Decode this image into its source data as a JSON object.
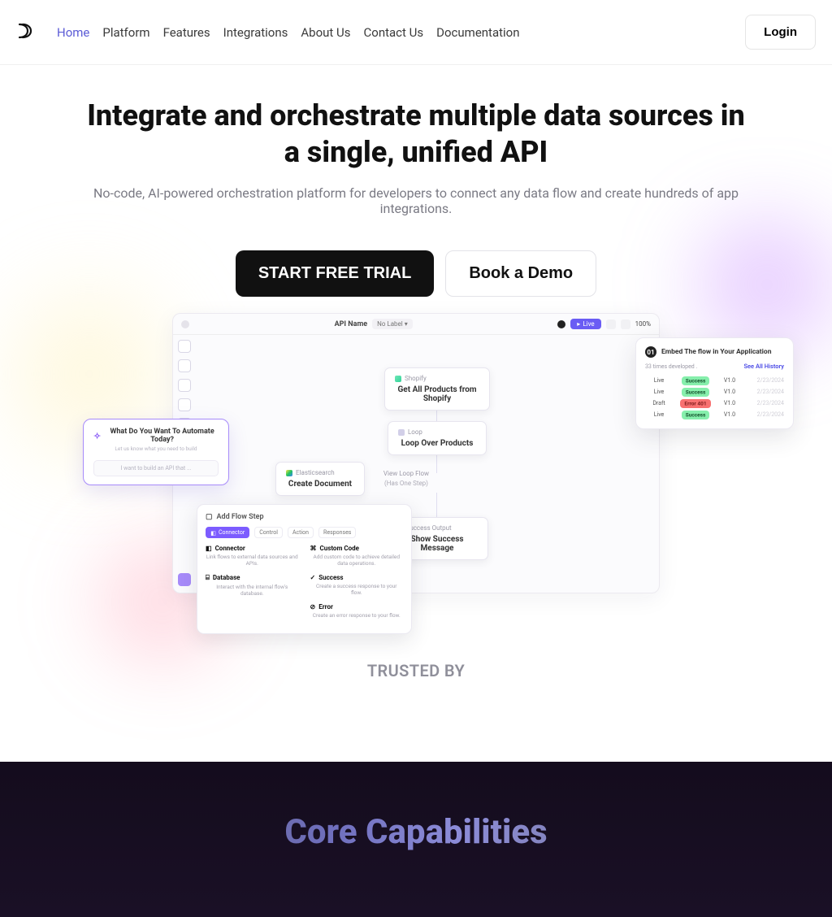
{
  "nav": {
    "links": [
      "Home",
      "Platform",
      "Features",
      "Integrations",
      "About Us",
      "Contact Us",
      "Documentation"
    ],
    "active_index": 0,
    "login": "Login"
  },
  "hero": {
    "title": "Integrate and orchestrate multiple data sources in a single, unified API",
    "subtitle": "No-code, AI-powered orchestration platform for developers to connect any data flow and create hundreds of app integrations.",
    "cta_primary": "START FREE TRIAL",
    "cta_secondary": "Book a Demo"
  },
  "mock": {
    "header": {
      "title": "API Name",
      "label": "No Label ▾",
      "live": "Live",
      "zoom": "100%"
    },
    "nodes": {
      "shopify": {
        "tag": "Shopify",
        "title": "Get All Products from Shopify"
      },
      "loop": {
        "tag": "Loop",
        "title": "Loop Over Products"
      },
      "elastic": {
        "tag": "Elasticsearch",
        "title": "Create Document"
      },
      "viewloop": {
        "tag": "View Loop Flow",
        "sub": "(Has One Step)"
      },
      "success": {
        "tag": "Success Output",
        "title": "Show Success Message"
      }
    },
    "automate": {
      "title": "What Do You Want To Automate Today?",
      "subtitle": "Let us know what you need to build",
      "placeholder": "I want to build an API that ..."
    },
    "add_step": {
      "header": "Add Flow Step",
      "chips": [
        "Connector",
        "Control",
        "Action",
        "Responses"
      ],
      "items": [
        {
          "t": "Connector",
          "d": "Link flows to external data sources and APIs."
        },
        {
          "t": "Database",
          "d": "Interact with the internal flow's database."
        },
        {
          "t": "Custom Code",
          "d": "Add custom code to achieve detailed data operations."
        },
        {
          "t": "Success",
          "d": "Create a success response to your flow."
        },
        {
          "t": "Error",
          "d": "Create an error response to your flow."
        }
      ]
    },
    "embed": {
      "title": "Embed The flow in Your Application",
      "count_label": "33 times developed .",
      "history_link": "See All History",
      "step_no": "01",
      "rows": [
        {
          "status": "Live",
          "result": "Success",
          "ver": "V1.0",
          "date": "2/23/2024",
          "ok": true
        },
        {
          "status": "Live",
          "result": "Success",
          "ver": "V1.0",
          "date": "2/23/2024",
          "ok": true
        },
        {
          "status": "Draft",
          "result": "Error 401",
          "ver": "V1.0",
          "date": "2/23/2024",
          "ok": false
        },
        {
          "status": "Live",
          "result": "Success",
          "ver": "V1.0",
          "date": "2/23/2024",
          "ok": true
        }
      ]
    }
  },
  "trusted": "TRUSTED BY",
  "core": {
    "heading": "Core Capabilities"
  },
  "colors": {
    "accent": "#5b5bd6",
    "primary_bg": "#111111",
    "violet": "#a78bfa"
  }
}
